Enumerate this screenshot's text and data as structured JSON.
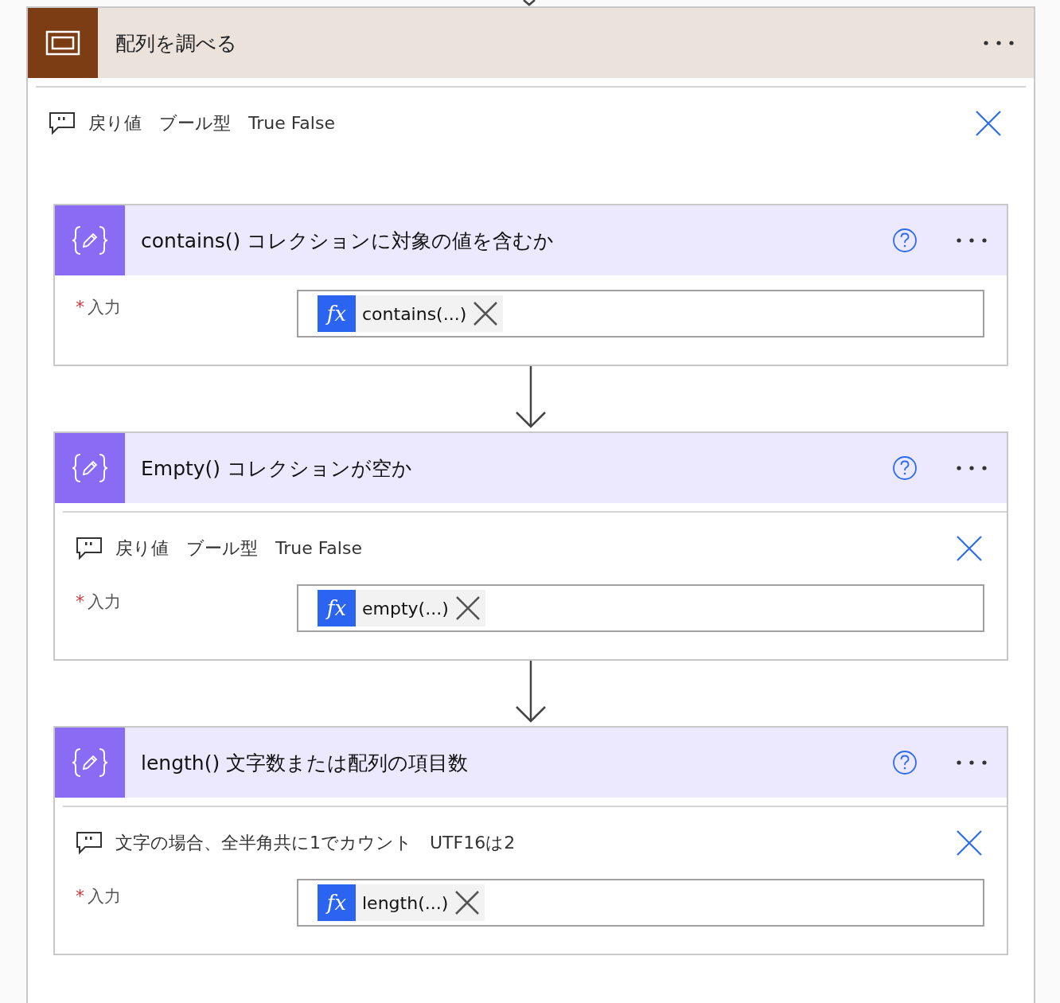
{
  "scope": {
    "title": "配列を調べる",
    "comment": {
      "parts": [
        "戻り値",
        "ブール型",
        "True False"
      ]
    },
    "steps": [
      {
        "title": "contains() コレクションに対象の値を含むか",
        "field": {
          "required_mark": "*",
          "label": "入力",
          "token_icon": "fx",
          "token": "contains(...)"
        }
      },
      {
        "title": "Empty() コレクションが空か",
        "comment": {
          "parts": [
            "戻り値",
            "ブール型",
            "True False"
          ]
        },
        "field": {
          "required_mark": "*",
          "label": "入力",
          "token_icon": "fx",
          "token": "empty(...)"
        }
      },
      {
        "title": "length() 文字数または配列の項目数",
        "comment": {
          "parts": [
            "文字の場合、全半角共に1でカウント",
            "UTF16は2"
          ]
        },
        "field": {
          "required_mark": "*",
          "label": "入力",
          "token_icon": "fx",
          "token": "length(...)"
        }
      }
    ]
  }
}
